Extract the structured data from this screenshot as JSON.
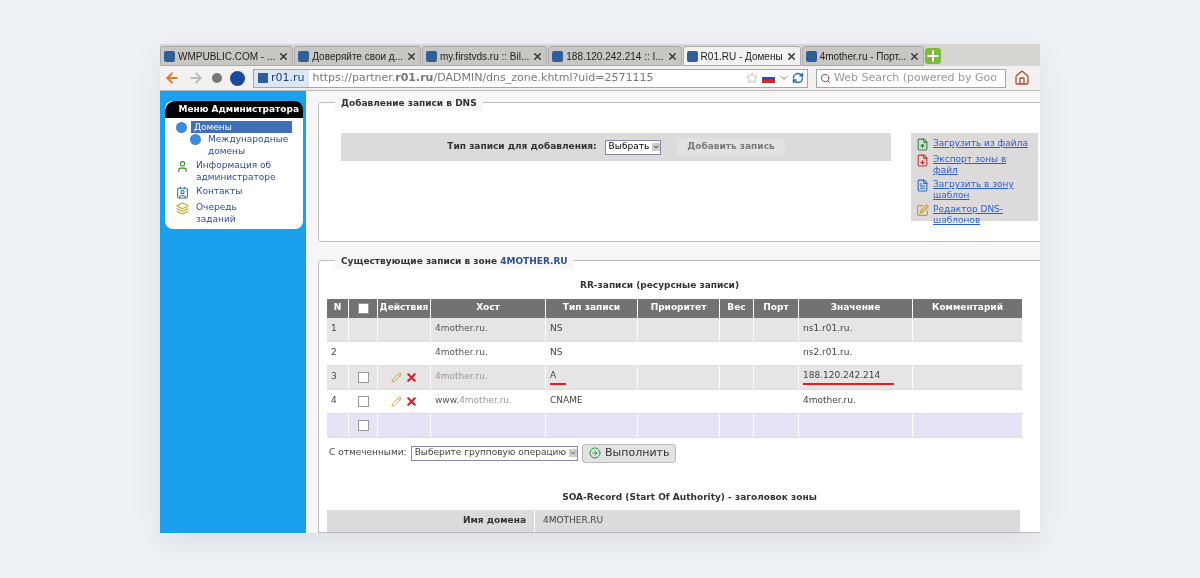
{
  "browser": {
    "tabs": [
      {
        "title": "WMPUBLIC.COM - ...",
        "selected": false
      },
      {
        "title": "Доверяйте свои д...",
        "selected": false
      },
      {
        "title": "my.firstvds.ru :: Bil...",
        "selected": false
      },
      {
        "title": "188.120.242.214 :: I...",
        "selected": false
      },
      {
        "title": "R01.RU - Домены",
        "selected": true
      },
      {
        "title": "4mother.ru - Порт...",
        "selected": false
      }
    ],
    "site_label": "r01.ru",
    "url": "https://partner.**r01.ru**/DADMIN/dns_zone.khtml?uid=2571115",
    "search_placeholder": "Web Search (powered by Goo"
  },
  "sidebar": {
    "title": "Меню Администратора",
    "items": [
      {
        "label": "Домены",
        "selected": true,
        "children": [
          {
            "label": "Международные домены",
            "selected": false
          }
        ]
      },
      {
        "label": "Информация об администраторе",
        "selected": false
      },
      {
        "label": "Контакты",
        "selected": false
      },
      {
        "label": "Очередь заданий",
        "selected": false
      }
    ]
  },
  "add_section": {
    "legend": "Добавление записи в DNS",
    "type_label": "Тип записи для добавления:",
    "type_select": "Выбрать",
    "add_button": {
      "label": "Добавить запись",
      "disabled": true
    },
    "links": [
      "Загрузить из файла",
      "Экспорт зоны в файл",
      "Загрузить в зону шаблон",
      "Редактор DNS-шаблонов"
    ]
  },
  "records_section": {
    "legend": "Существующие записи в зоне",
    "zone": "4MOTHER.RU",
    "table_title": "RR-записи (ресурсные записи)",
    "columns": [
      "N",
      "Действия",
      "Хост",
      "Тип записи",
      "Приоритет",
      "Вес",
      "Порт",
      "Значение",
      "Комментарий"
    ],
    "header_checked": false,
    "rows": [
      {
        "kind": "system",
        "n": "1",
        "host_prefix": "",
        "host": "4mother.ru.",
        "host_dim": false,
        "type": "NS",
        "type_underlined": false,
        "value": "ns1.r01.ru.",
        "value_underlined": false
      },
      {
        "kind": "system",
        "n": "2",
        "host_prefix": "",
        "host": "4mother.ru.",
        "host_dim": false,
        "type": "NS",
        "type_underlined": false,
        "value": "ns2.r01.ru.",
        "value_underlined": false
      },
      {
        "kind": "editable",
        "n": "3",
        "checked": false,
        "host_prefix": "",
        "host": "4mother.ru.",
        "host_dim": true,
        "type": "A",
        "type_underlined": true,
        "value": "188.120.242.214",
        "value_underlined": true
      },
      {
        "kind": "editable",
        "n": "4",
        "checked": false,
        "host_prefix": "www.",
        "host": "4mother.ru.",
        "host_dim": true,
        "type": "CNAME",
        "type_underlined": false,
        "value": "4mother.ru.",
        "value_underlined": false
      },
      {
        "kind": "new",
        "checked": false
      }
    ],
    "bulk_label": "С отмеченными:",
    "bulk_select": "Выберите групповую операцию",
    "bulk_button": "Выполнить"
  },
  "soa": {
    "title": "SOA-Record (Start Of Authority) - заголовок зоны",
    "rows": [
      {
        "label": "Имя домена",
        "value": "4MOTHER.RU"
      }
    ]
  }
}
